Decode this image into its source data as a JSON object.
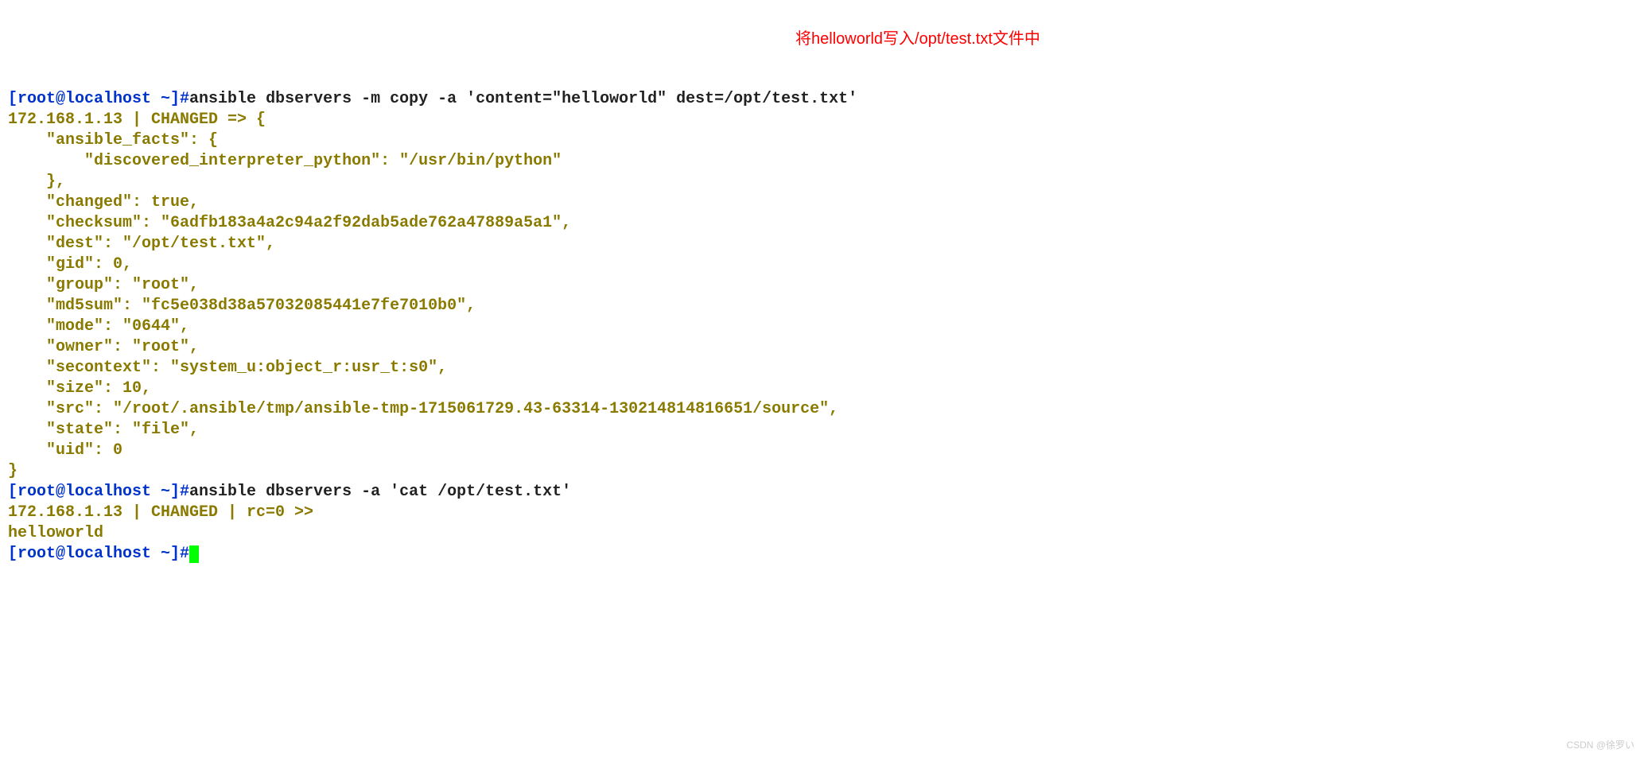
{
  "prompt1": {
    "user_host": "[root@localhost ",
    "path": "~]#",
    "command": "ansible dbservers -m copy -a 'content=\"helloworld\" dest=/opt/test.txt'"
  },
  "annotation1": "将helloworld写入/opt/test.txt文件中",
  "output1": {
    "header": "172.168.1.13 | CHANGED => {",
    "lines": [
      "    \"ansible_facts\": {",
      "        \"discovered_interpreter_python\": \"/usr/bin/python\"",
      "    },",
      "    \"changed\": true,",
      "    \"checksum\": \"6adfb183a4a2c94a2f92dab5ade762a47889a5a1\",",
      "    \"dest\": \"/opt/test.txt\",",
      "    \"gid\": 0,",
      "    \"group\": \"root\",",
      "    \"md5sum\": \"fc5e038d38a57032085441e7fe7010b0\",",
      "    \"mode\": \"0644\",",
      "    \"owner\": \"root\",",
      "    \"secontext\": \"system_u:object_r:usr_t:s0\",",
      "    \"size\": 10,",
      "    \"src\": \"/root/.ansible/tmp/ansible-tmp-1715061729.43-63314-130214814816651/source\",",
      "    \"state\": \"file\",",
      "    \"uid\": 0",
      "}"
    ]
  },
  "prompt2": {
    "user_host": "[root@localhost ",
    "path": "~]#",
    "command": "ansible dbservers -a 'cat /opt/test.txt'"
  },
  "output2": {
    "header": "172.168.1.13 | CHANGED | rc=0 >>",
    "body": "helloworld"
  },
  "prompt3": {
    "user_host": "[root@localhost ",
    "path": "~]#"
  },
  "watermark": "CSDN @徐罗い"
}
